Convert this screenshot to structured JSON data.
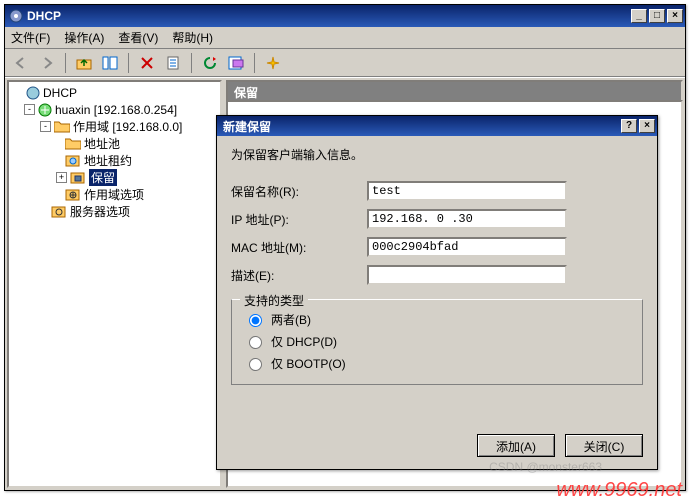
{
  "window": {
    "title": "DHCP"
  },
  "menu": {
    "file": "文件(F)",
    "action": "操作(A)",
    "view": "查看(V)",
    "help": "帮助(H)"
  },
  "tree": {
    "root": "DHCP",
    "server": "huaxin [192.168.0.254]",
    "scope": "作用域 [192.168.0.0]",
    "pool": "地址池",
    "lease": "地址租约",
    "reservation": "保留",
    "scopeopt": "作用域选项",
    "serveropt": "服务器选项"
  },
  "pane": {
    "title": "保留"
  },
  "dialog": {
    "title": "新建保留",
    "intro": "为保留客户端输入信息。",
    "name_label": "保留名称(R):",
    "name_value": "test",
    "ip_label": "IP 地址(P):",
    "ip_value": "192.168. 0 .30",
    "mac_label": "MAC 地址(M):",
    "mac_value": "000c2904bfad",
    "desc_label": "描述(E):",
    "desc_value": "",
    "group_label": "支持的类型",
    "radio_both": "两者(B)",
    "radio_dhcp": "仅 DHCP(D)",
    "radio_bootp": "仅 BOOTP(O)",
    "btn_add": "添加(A)",
    "btn_close": "关闭(C)"
  },
  "watermark": {
    "csdn": "CSDN @monster663",
    "url": "www.9969.net"
  }
}
